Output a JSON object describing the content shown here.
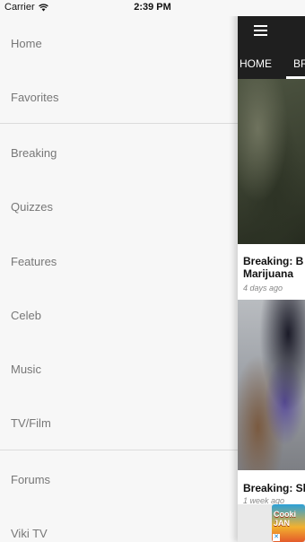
{
  "status_bar": {
    "carrier": "Carrier",
    "time": "2:39 PM"
  },
  "drawer": {
    "items": [
      {
        "label": "Home"
      },
      {
        "label": "Favorites"
      },
      {
        "label": "Breaking"
      },
      {
        "label": "Quizzes"
      },
      {
        "label": "Features"
      },
      {
        "label": "Celeb"
      },
      {
        "label": "Music"
      },
      {
        "label": "TV/Film"
      },
      {
        "label": "Forums"
      },
      {
        "label": "Viki TV"
      }
    ]
  },
  "main": {
    "tabs": [
      {
        "label": "HOME",
        "active": false
      },
      {
        "label": "BR",
        "active": true
      }
    ],
    "articles": [
      {
        "title_line1": "Breaking: B",
        "title_line2": "Marijuana",
        "time": "4 days ago"
      },
      {
        "title_line1": "Breaking: Sl",
        "title_line2": "",
        "time": "1 week ago"
      }
    ],
    "ad": {
      "text_line1": "Cooki",
      "text_line2": "JAN"
    }
  },
  "colors": {
    "drawer_bg": "#f7f7f7",
    "topbar_bg": "#1f1f1f",
    "drawer_text": "#777777",
    "divider": "#dcdcdc"
  },
  "icons": {
    "wifi": "wifi-icon",
    "menu": "hamburger-menu-icon",
    "battery": "battery-icon",
    "ad_close": "ad-close-icon"
  }
}
